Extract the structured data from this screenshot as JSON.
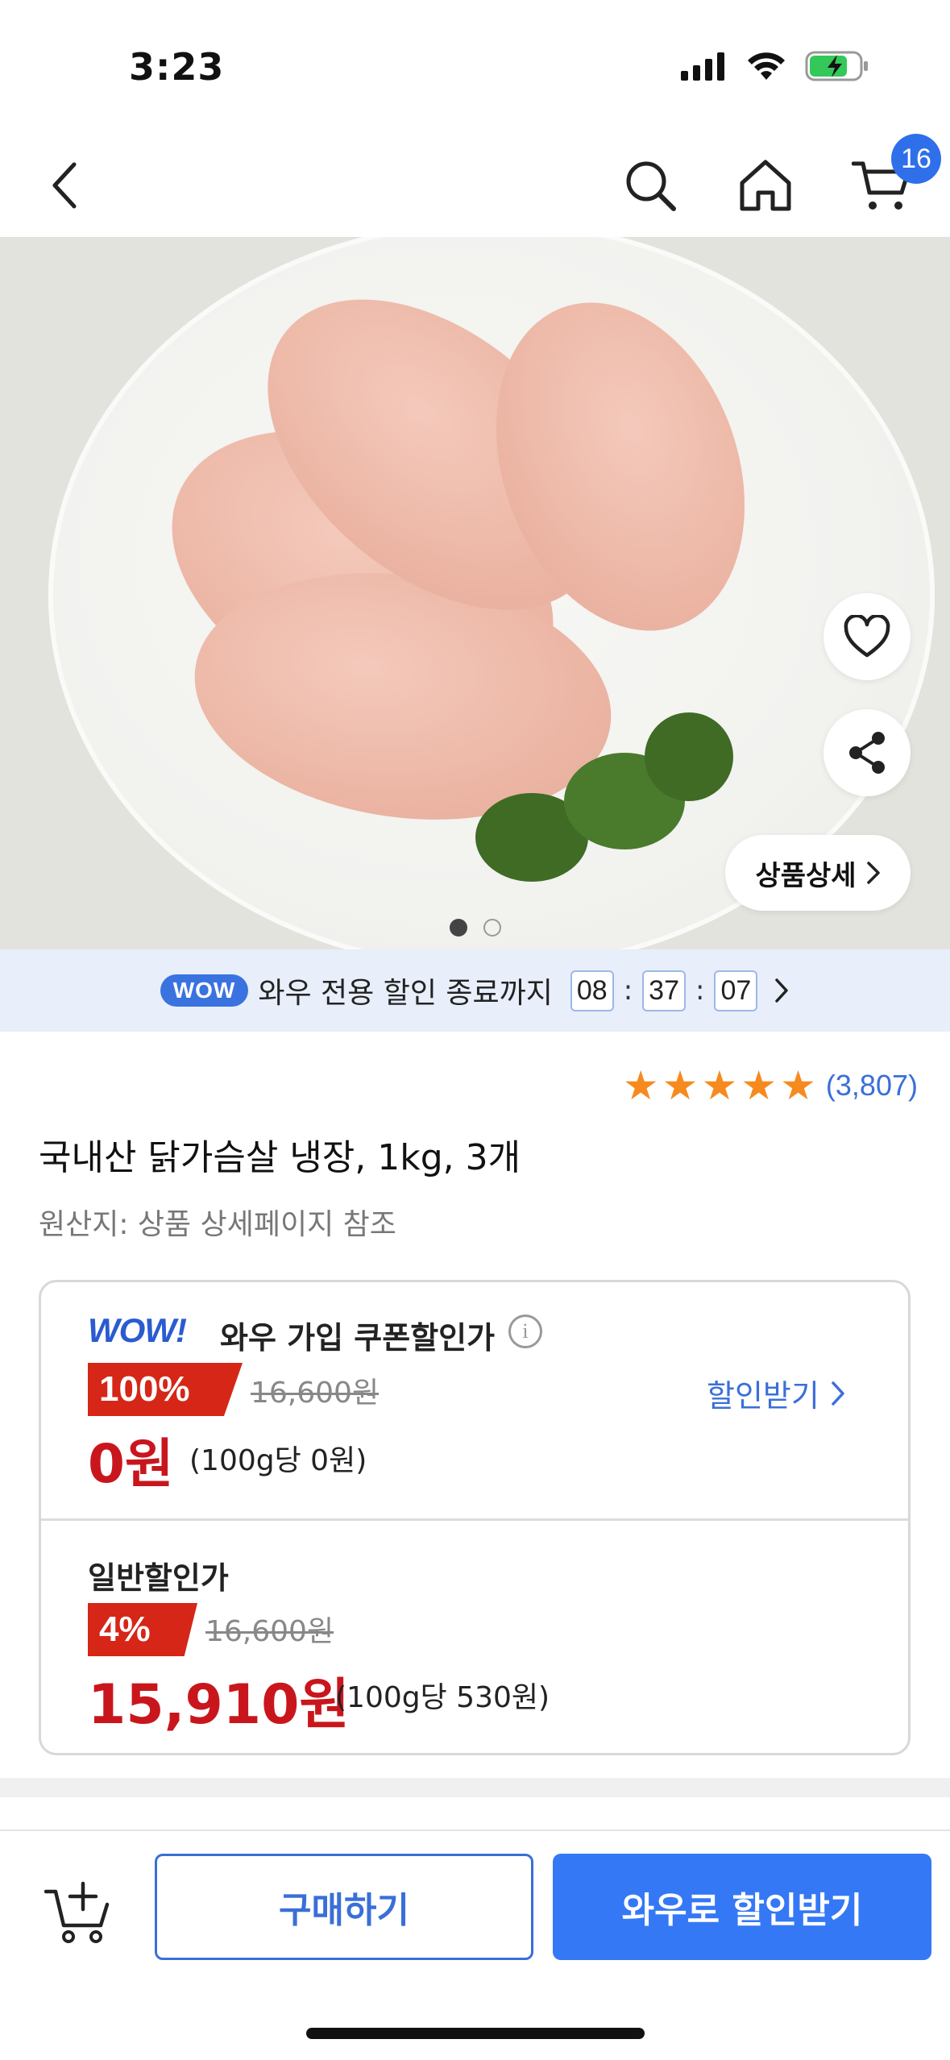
{
  "status_bar": {
    "time": "3:23"
  },
  "nav": {
    "cart_count": "16"
  },
  "product_image": {
    "active_index": 0,
    "total": 2
  },
  "detail_button": {
    "label": "상품상세"
  },
  "timer": {
    "badge": "WOW",
    "text": "와우 전용 할인 종료까지",
    "hours": "08",
    "minutes": "37",
    "seconds": "07",
    "separator": ":"
  },
  "rating": {
    "stars": 5,
    "count": "(3,807)"
  },
  "product": {
    "title": "국내산 닭가슴살 냉장, 1kg, 3개",
    "origin": "원산지: 상품 상세페이지 참조"
  },
  "wow_price": {
    "logo": "WOW!",
    "label": "와우 가입 쿠폰할인가",
    "discount": "100%",
    "original": "16,600원",
    "price": "0원",
    "unit_price": "(100g당 0원)",
    "claim_label": "할인받기"
  },
  "normal_price": {
    "label": "일반할인가",
    "discount": "4%",
    "original": "16,600원",
    "price": "15,910원",
    "unit_price": "(100g당 530원)"
  },
  "bottom_bar": {
    "buy_label": "구매하기",
    "wow_buy_label": "와우로 할인받기"
  },
  "colors": {
    "accent_blue": "#3478f6",
    "price_red": "#c9161d",
    "tag_red": "#d52617",
    "star_orange": "#f68a1e"
  }
}
